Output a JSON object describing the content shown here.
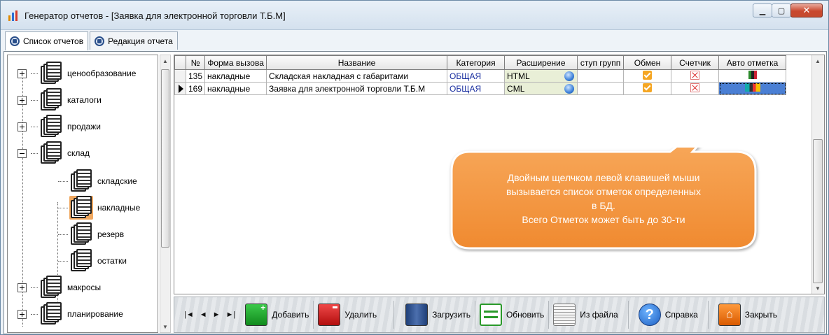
{
  "window": {
    "title": "Генератор отчетов - [Заявка для электронной торговли Т.Б.М]"
  },
  "tabs": [
    {
      "label": "Список отчетов",
      "active": true
    },
    {
      "label": "Редакция отчета",
      "active": false
    }
  ],
  "tree": {
    "items": [
      {
        "label": "ценообразование",
        "expander": "plus",
        "level": 0
      },
      {
        "label": "каталоги",
        "expander": "plus",
        "level": 0
      },
      {
        "label": "продажи",
        "expander": "plus",
        "level": 0
      },
      {
        "label": "склад",
        "expander": "minus",
        "level": 0
      },
      {
        "label": "складские",
        "level": 1
      },
      {
        "label": "накладные",
        "level": 1,
        "selected": true
      },
      {
        "label": "резерв",
        "level": 1
      },
      {
        "label": "остатки",
        "level": 1
      },
      {
        "label": "макросы",
        "expander": "plus",
        "level": 0
      },
      {
        "label": "планирование",
        "expander": "plus",
        "level": 0
      }
    ]
  },
  "grid": {
    "columns": [
      "№",
      "Форма вызова",
      "Название",
      "Категория",
      "Расширение",
      "ступ групп",
      "Обмен",
      "Счетчик",
      "Авто отметка"
    ],
    "rows": [
      {
        "num": "135",
        "form": "накладные",
        "name": "Складская накладная с габаритами",
        "category": "ОБЩАЯ",
        "ext": "HTML",
        "group": "",
        "exchange": true,
        "counter": false,
        "current": false
      },
      {
        "num": "169",
        "form": "накладные",
        "name": "Заявка для электронной торговли Т.Б.М",
        "category": "ОБЩАЯ",
        "ext": "CML",
        "group": "",
        "exchange": true,
        "counter": false,
        "current": true
      }
    ]
  },
  "callout": {
    "lines": [
      "Двойным щелчком левой клавишей мыши",
      "вызывается список отметок определенных",
      "в БД.",
      "Всего Отметок может быть до 30-ти"
    ],
    "fill": "#f6a04c",
    "text_color": "#ffffff"
  },
  "toolbar": {
    "nav": [
      "|◄",
      "◄",
      "►",
      "►|"
    ],
    "add": "Добавить",
    "delete": "Удалить",
    "load": "Загрузить",
    "refresh": "Обновить",
    "from_file": "Из файла",
    "help": "Справка",
    "close": "Закрыть"
  }
}
